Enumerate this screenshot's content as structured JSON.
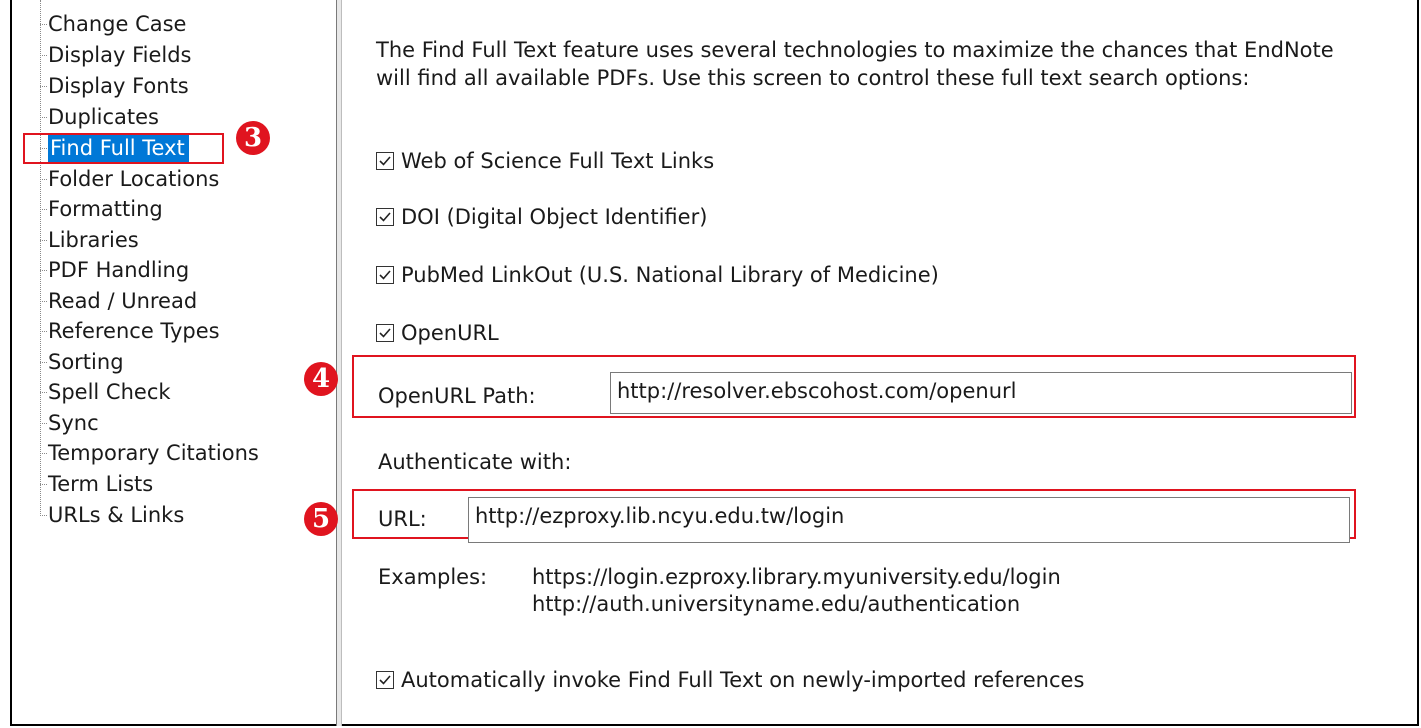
{
  "tree": {
    "items": [
      {
        "label": "Change Case"
      },
      {
        "label": "Display Fields"
      },
      {
        "label": "Display Fonts"
      },
      {
        "label": "Duplicates"
      },
      {
        "label": "Find Full Text",
        "selected": true
      },
      {
        "label": "Folder Locations"
      },
      {
        "label": "Formatting"
      },
      {
        "label": "Libraries"
      },
      {
        "label": "PDF Handling"
      },
      {
        "label": "Read / Unread"
      },
      {
        "label": "Reference Types"
      },
      {
        "label": "Sorting"
      },
      {
        "label": "Spell Check"
      },
      {
        "label": "Sync"
      },
      {
        "label": "Temporary Citations"
      },
      {
        "label": "Term Lists"
      },
      {
        "label": "URLs & Links"
      }
    ]
  },
  "badges": {
    "step3": "3",
    "step4": "4",
    "step5": "5"
  },
  "panel": {
    "intro": "The Find Full Text feature uses several technologies to maximize the chances that EndNote will find all available PDFs. Use this screen to control these full text search options:",
    "options": [
      {
        "label": "Web of Science Full Text Links",
        "checked": true
      },
      {
        "label": "DOI (Digital Object Identifier)",
        "checked": true
      },
      {
        "label": "PubMed LinkOut (U.S. National Library of Medicine)",
        "checked": true
      },
      {
        "label": "OpenURL",
        "checked": true
      }
    ],
    "openurl_path_label": "OpenURL Path:",
    "openurl_path_value": "http://resolver.ebscohost.com/openurl",
    "authenticate_label": "Authenticate with:",
    "url_label": "URL:",
    "url_value": "http://ezproxy.lib.ncyu.edu.tw/login",
    "examples_label": "Examples:",
    "example_1": "https://login.ezproxy.library.myuniversity.edu/login",
    "example_2": "http://auth.universityname.edu/authentication",
    "auto_invoke_label": "Automatically invoke Find Full Text on newly-imported references",
    "auto_invoke_checked": true
  },
  "colors": {
    "selection": "#0078d7",
    "annotation_red": "#e0141f"
  }
}
